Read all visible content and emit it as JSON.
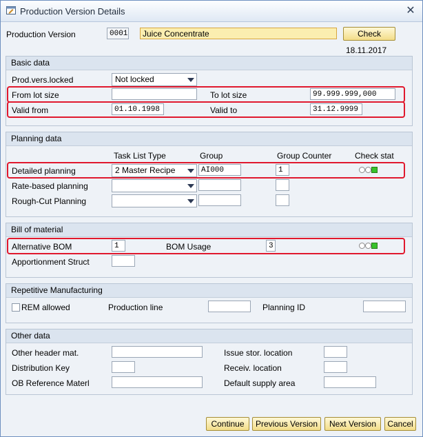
{
  "window": {
    "title": "Production Version Details",
    "close_icon": "close-icon"
  },
  "header": {
    "prod_version_label": "Production Version",
    "prod_version_value": "0001",
    "description_value": "Juice Concentrate",
    "check_label": "Check",
    "date": "18.11.2017"
  },
  "basic": {
    "title": "Basic data",
    "locked_label": "Prod.vers.locked",
    "locked_value": "Not locked",
    "from_lot_label": "From lot size",
    "from_lot_value": "",
    "to_lot_label": "To lot size",
    "to_lot_value": "99.999.999,000",
    "valid_from_label": "Valid from",
    "valid_from_value": "01.10.1998",
    "valid_to_label": "Valid to",
    "valid_to_value": "31.12.9999"
  },
  "planning": {
    "title": "Planning data",
    "col_task_list_type": "Task List Type",
    "col_group": "Group",
    "col_group_counter": "Group Counter",
    "col_check_stat": "Check stat",
    "rows": [
      {
        "label": "Detailed planning",
        "task_list_type": "2 Master Recipe",
        "group": "AI000",
        "counter": "1"
      },
      {
        "label": "Rate-based planning",
        "task_list_type": "",
        "group": "",
        "counter": ""
      },
      {
        "label": "Rough-Cut Planning",
        "task_list_type": "",
        "group": "",
        "counter": ""
      }
    ]
  },
  "bom": {
    "title": "Bill of material",
    "alt_label": "Alternative BOM",
    "alt_value": "1",
    "usage_label": "BOM Usage",
    "usage_value": "3",
    "apportion_label": "Apportionment Struct",
    "apportion_value": ""
  },
  "rem": {
    "title": "Repetitive Manufacturing",
    "rem_allowed_label": "REM allowed",
    "production_line_label": "Production line",
    "planning_id_label": "Planning ID"
  },
  "other": {
    "title": "Other data",
    "other_header_label": "Other header mat.",
    "distribution_key_label": "Distribution Key",
    "ob_reference_label": "OB Reference Materl",
    "issue_stor_label": "Issue stor. location",
    "receiv_label": "Receiv. location",
    "default_supply_label": "Default supply area"
  },
  "footer": {
    "continue": "Continue",
    "previous": "Previous Version",
    "next": "Next Version",
    "cancel": "Cancel"
  },
  "colors": {
    "highlight": "#e0182d",
    "check_green": "#38c22c",
    "button_yellow": "#f3dd89"
  }
}
